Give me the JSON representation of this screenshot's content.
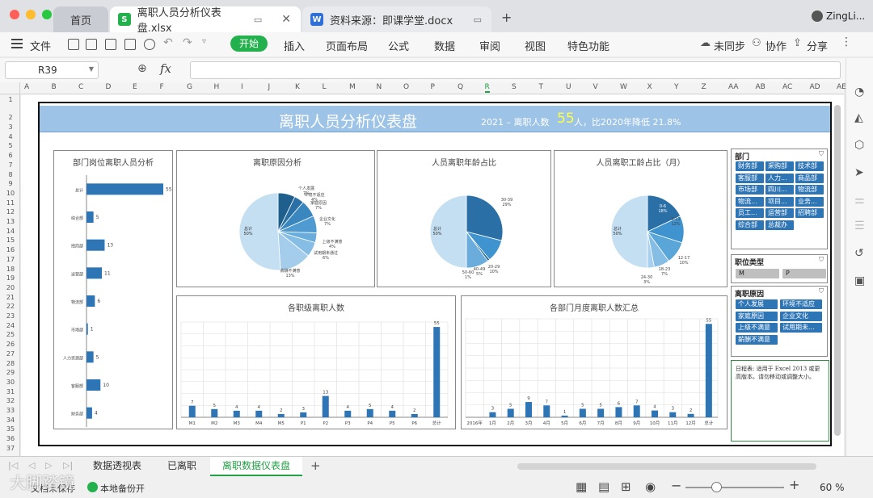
{
  "tabs": [
    {
      "label": "首页"
    },
    {
      "label": "离职人员分析仪表盘.xlsx",
      "icon": "S"
    },
    {
      "label": "资料来源：即课学堂.docx",
      "icon": "W"
    }
  ],
  "user": "ZingLi...",
  "menu": {
    "file": "文件",
    "start": "开始",
    "items": [
      "插入",
      "页面布局",
      "公式",
      "数据",
      "审阅",
      "视图",
      "特色功能"
    ],
    "unsync": "未同步",
    "collab": "协作",
    "share": "分享"
  },
  "formula": {
    "cell": "R39",
    "fx": "fx"
  },
  "columns": [
    "A",
    "B",
    "C",
    "D",
    "E",
    "F",
    "G",
    "H",
    "I",
    "J",
    "K",
    "L",
    "M",
    "N",
    "O",
    "P",
    "Q",
    "R",
    "S",
    "T",
    "U",
    "V",
    "W",
    "X",
    "Y",
    "Z",
    "AA",
    "AB",
    "AC",
    "AD",
    "AE"
  ],
  "rows": [
    "1",
    "2",
    "3",
    "4",
    "5",
    "6",
    "7",
    "8",
    "9",
    "10",
    "11",
    "12",
    "13",
    "14",
    "15",
    "16",
    "17",
    "18",
    "19",
    "20",
    "21",
    "22",
    "23",
    "24",
    "25",
    "26",
    "27",
    "28",
    "29",
    "30",
    "31",
    "32",
    "33",
    "34",
    "35",
    "36",
    "37"
  ],
  "dashboard": {
    "title": "离职人员分析仪表盘",
    "summary_prefix": "2021 – 离职人数",
    "summary_count": "55",
    "summary_suffix": "人，比2020年降低 21.8%"
  },
  "panels": {
    "dept": "部门岗位离职人员分析",
    "reason": "离职原因分析",
    "age": "人员离职年龄占比",
    "tenure": "人员离职工龄占比（月）",
    "level": "各职级离职人数",
    "monthly": "各部门月度离职人数汇总"
  },
  "chart_data": [
    {
      "type": "bar",
      "orientation": "horizontal",
      "title": "部门岗位离职人员分析",
      "categories": [
        "总计",
        "综合部",
        "招商部",
        "运营部",
        "物流部",
        "市场部",
        "人力资源部",
        "客服部",
        "财务部"
      ],
      "values": [
        55,
        5,
        13,
        11,
        6,
        1,
        5,
        10,
        4
      ]
    },
    {
      "type": "pie",
      "title": "离职原因分析",
      "labels": [
        "个人发展",
        "环境不适应",
        "家庭原因",
        "企业文化",
        "上级不满意",
        "试用期未通过",
        "薪酬不满意",
        "总计"
      ],
      "values": [
        7,
        4,
        7,
        7,
        4,
        6,
        13,
        50
      ],
      "label_text": [
        "个人发展\n7%",
        "环境不适应\n4%",
        "家庭原因\n7%",
        "企业文化\n7%",
        "上级不满意\n4%",
        "试用期未通过\n6%",
        "薪酬不满意\n13%",
        "总计\n50%"
      ]
    },
    {
      "type": "pie",
      "title": "人员离职年龄占比",
      "labels": [
        "30-39",
        "20-29",
        "50-60",
        "40-49",
        "总计"
      ],
      "values": [
        29,
        10,
        1,
        10,
        50
      ],
      "label_text": [
        "30-39\n29%",
        "20-29\n10%",
        "50-60\n1%",
        "40-49\n5%",
        "总计\n50%"
      ]
    },
    {
      "type": "pie",
      "title": "人员离职工龄占比（月）",
      "labels": [
        "0-6",
        "6-11",
        "12-17",
        "18-23",
        "24-35",
        "总计"
      ],
      "values": [
        18,
        12,
        10,
        7,
        3,
        50
      ],
      "label_text": [
        "0-6\n18%",
        "6-11\n12%",
        "12-17\n10%",
        "18-23\n7%",
        "24-30\n3%",
        "总计\n50%"
      ]
    },
    {
      "type": "bar",
      "title": "各职级离职人数",
      "categories": [
        "M1",
        "M2",
        "M3",
        "M4",
        "M5",
        "P1",
        "P2",
        "P3",
        "P4",
        "P5",
        "P6",
        "总计"
      ],
      "values": [
        7,
        5,
        4,
        4,
        2,
        3,
        13,
        4,
        5,
        4,
        2,
        55
      ]
    },
    {
      "type": "bar",
      "title": "各部门月度离职人数汇总",
      "categories": [
        "2016年",
        "1月",
        "2月",
        "3月",
        "4月",
        "5月",
        "6月",
        "7月",
        "8月",
        "9月",
        "10月",
        "11月",
        "12月",
        "总计"
      ],
      "values": [
        0,
        3,
        5,
        9,
        7,
        1,
        5,
        5,
        6,
        7,
        4,
        3,
        2,
        55
      ]
    }
  ],
  "slicers": {
    "dept": {
      "title": "部门",
      "items": [
        "财务部",
        "采购部",
        "技术部",
        "客服部",
        "人力...",
        "商品部",
        "市场部",
        "四川...",
        "物流部",
        "物流...",
        "项目...",
        "业务...",
        "员工...",
        "运营部",
        "招聘部",
        "综合部",
        "总裁办"
      ]
    },
    "type": {
      "title": "职位类型",
      "items": [
        "M",
        "P"
      ]
    },
    "reason": {
      "title": "离职原因",
      "items": [
        "个人发展",
        "环境不适应",
        "家庭原因",
        "企业文化",
        "上级不满意",
        "试用期未...",
        "薪酬不满意"
      ]
    },
    "note": "日程表: 适用于 Excel 2013 或更高版本。请勿移动或调整大小。"
  },
  "sheets": [
    "数据透视表",
    "已离职",
    "离职数据仪表盘"
  ],
  "status": {
    "doc": "文档未保存",
    "backup": "本地备份开",
    "zoom": "60 %"
  },
  "watermark": "大脚踏镜",
  "colors": {
    "accent": "#2e75b6",
    "header": "#9dc3e6",
    "green": "#22b14c"
  }
}
